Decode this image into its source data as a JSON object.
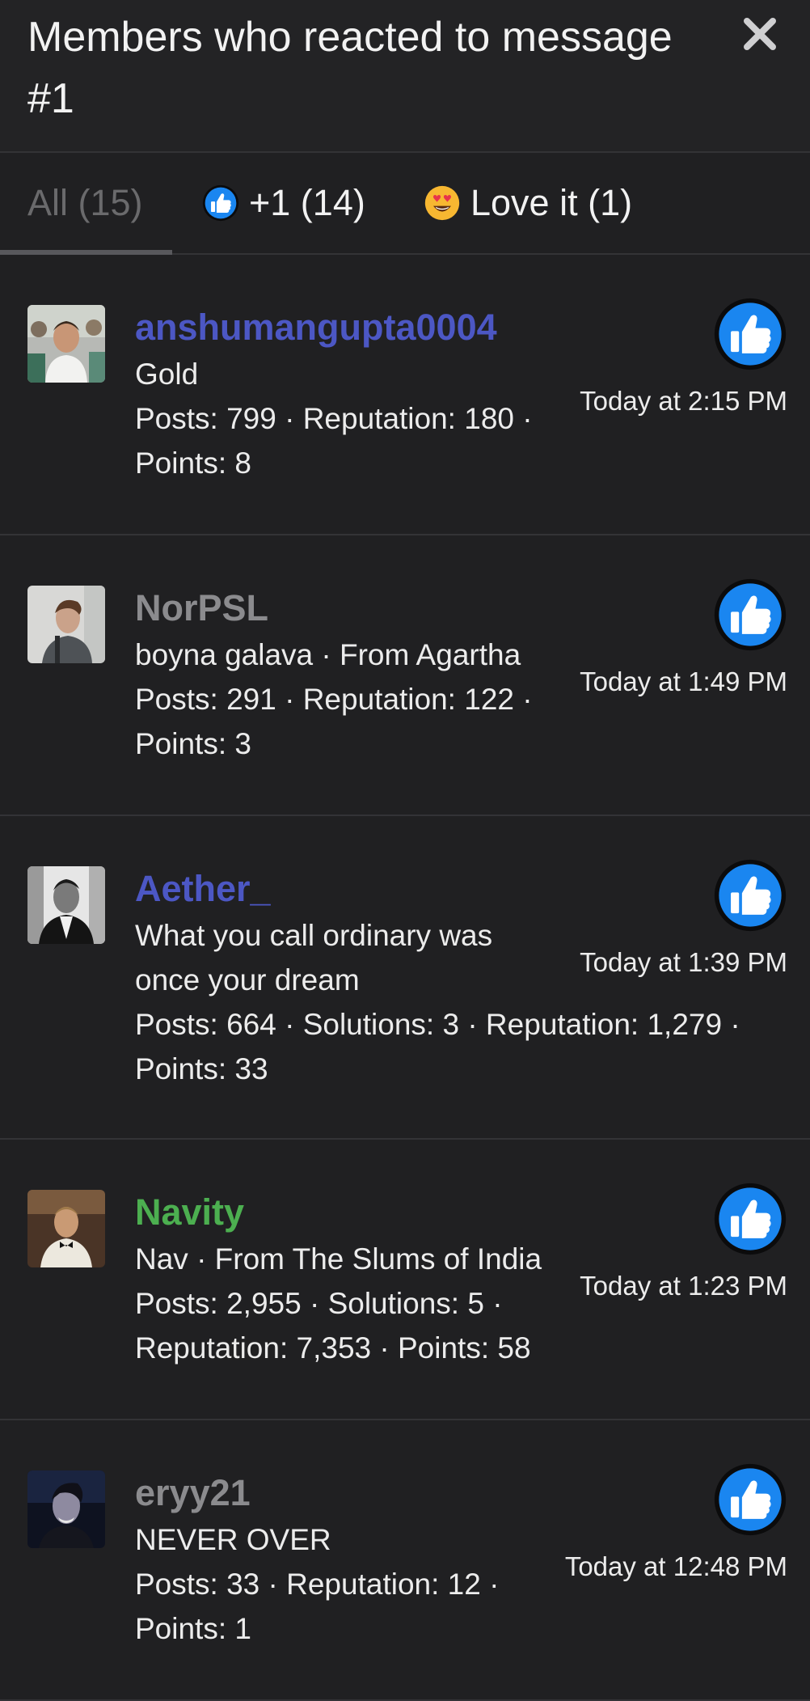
{
  "header": {
    "title": "Members who reacted to message #1",
    "close_icon": "close-icon"
  },
  "tabs": [
    {
      "label": "All (15)",
      "icon": null,
      "active": true
    },
    {
      "label": "+1 (14)",
      "icon": "thumbs-up-icon"
    },
    {
      "label": "Love it (1)",
      "icon": "heart-eyes-emoji-icon"
    }
  ],
  "members": [
    {
      "username": "anshumangupta0004",
      "name_color": "#4c57c4",
      "line1": "Gold",
      "line2": "Posts: 799 · Reputation: 180 ·",
      "line3": "Points: 8",
      "time": "Today at 2:15 PM",
      "reaction_icon": "thumbs-up-icon"
    },
    {
      "username": "NorPSL",
      "name_color": "#8b8b8e",
      "line1": "boyna galava · From Agartha",
      "line2": "Posts: 291 · Reputation: 122 ·",
      "line3": "Points: 3",
      "time": "Today at 1:49 PM",
      "reaction_icon": "thumbs-up-icon"
    },
    {
      "username": "Aether_",
      "name_color": "#4c57c4",
      "line1": "What you call ordinary was",
      "line1b": "once your dream",
      "line2": "Posts: 664 · Solutions: 3 · Reputation: 1,279 ·",
      "line3": "Points: 33",
      "time": "Today at 1:39 PM",
      "reaction_icon": "thumbs-up-icon"
    },
    {
      "username": "Navity",
      "name_color": "#4caf50",
      "line1": "Nav · From The Slums of India",
      "line2": "Posts: 2,955 · Solutions: 5 ·",
      "line3": "Reputation: 7,353 · Points: 58",
      "time": "Today at 1:23 PM",
      "reaction_icon": "thumbs-up-icon"
    },
    {
      "username": "eryy21",
      "name_color": "#8b8b8e",
      "line1": "NEVER OVER",
      "line2": "Posts: 33 · Reputation: 12 ·",
      "line3": "Points: 1",
      "time": "Today at 12:48 PM",
      "reaction_icon": "thumbs-up-icon"
    }
  ],
  "colors": {
    "background": "#202022",
    "like_blue": "#1a86f0",
    "divider": "#333336"
  }
}
